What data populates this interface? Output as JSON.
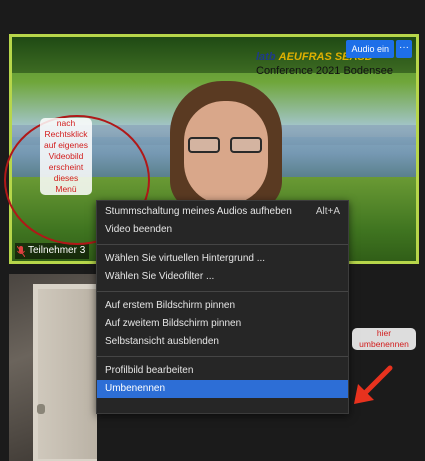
{
  "video": {
    "conference_brand_prefix": "latb",
    "conference_brand_suffix": "AEUFRAS SEASD",
    "conference_title": "Conference 2021 Bodensee",
    "audio_button": "Audio ein",
    "more_button": "···",
    "participant_label": "Teilnehmer 3",
    "border_color": "#b7d64a"
  },
  "annotations": {
    "left_note": [
      "nach",
      "Rechtsklick",
      "auf eigenes",
      "Videobild",
      "erscheint",
      "dieses",
      "Menü"
    ],
    "right_note": [
      "hier",
      "umbenennen"
    ],
    "color": "#d21d1d"
  },
  "context_menu": {
    "groups": [
      [
        {
          "label": "Stummschaltung meines Audios aufheben",
          "shortcut": "Alt+A"
        },
        {
          "label": "Video beenden",
          "shortcut": ""
        }
      ],
      [
        {
          "label": "Wählen Sie virtuellen Hintergrund ...",
          "shortcut": ""
        },
        {
          "label": "Wählen Sie Videofilter ...",
          "shortcut": ""
        }
      ],
      [
        {
          "label": "Auf erstem Bildschirm pinnen",
          "shortcut": ""
        },
        {
          "label": "Auf zweitem Bildschirm pinnen",
          "shortcut": ""
        },
        {
          "label": "Selbstansicht ausblenden",
          "shortcut": ""
        }
      ],
      [
        {
          "label": "Profilbild bearbeiten",
          "shortcut": ""
        },
        {
          "label": "Umbenennen",
          "shortcut": ""
        }
      ]
    ],
    "selected_item": "Umbenennen",
    "highlight_color": "#2d6ed6"
  }
}
